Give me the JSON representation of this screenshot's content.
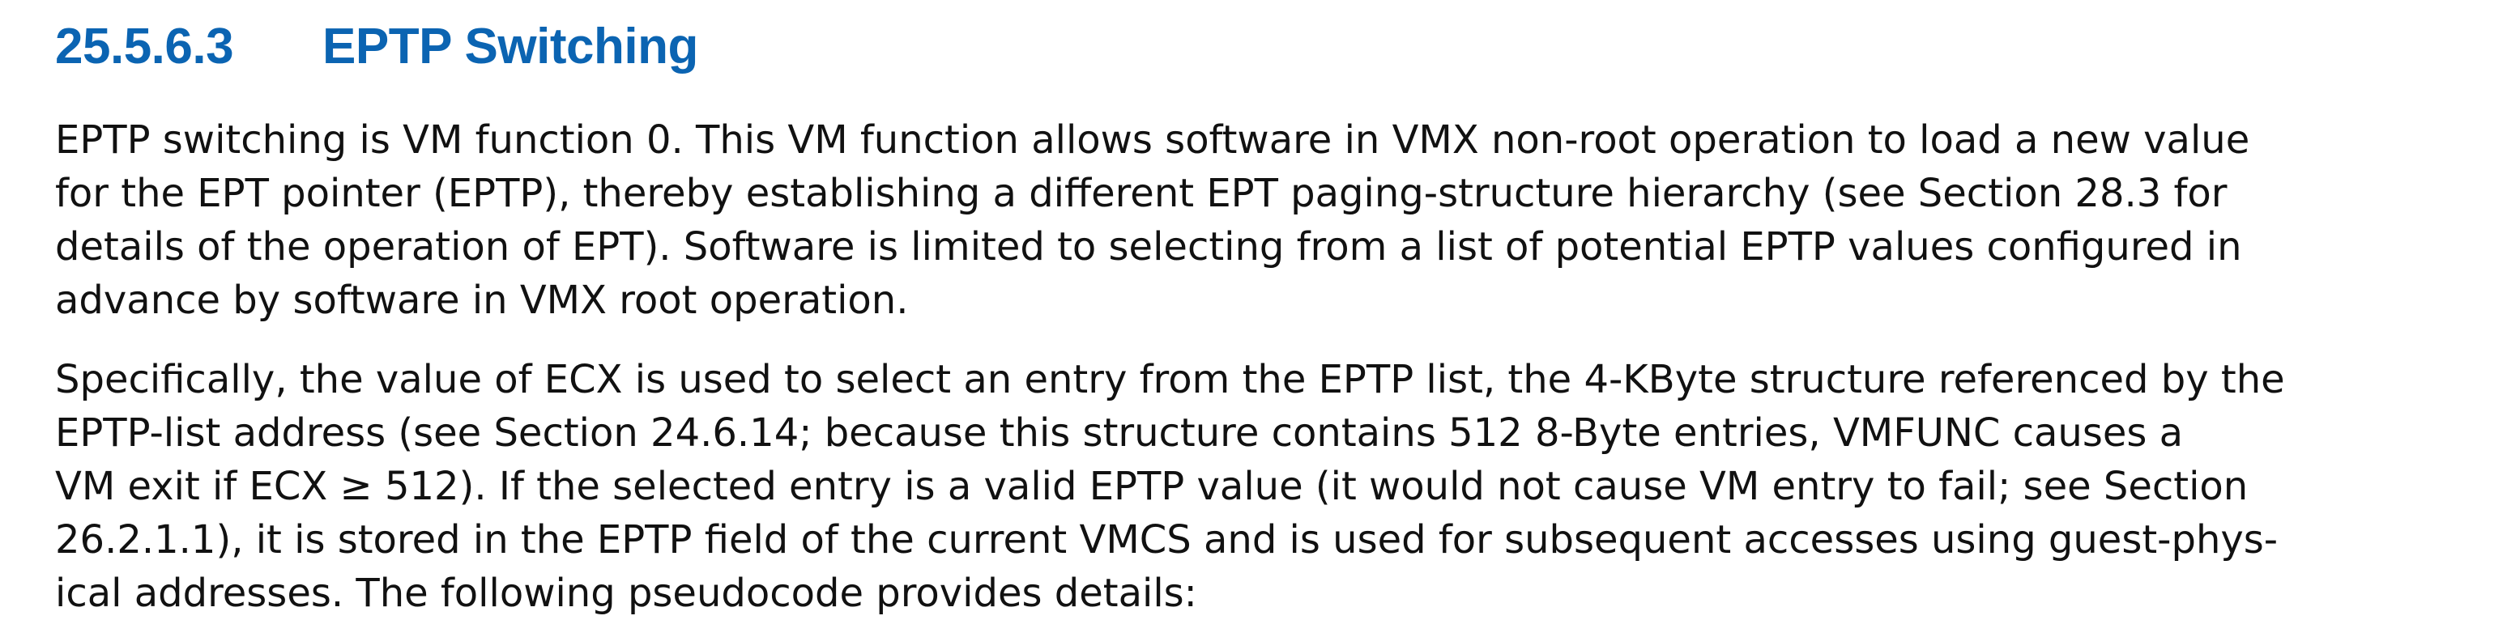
{
  "section": {
    "number": "25.5.6.3",
    "title": "EPTP Switching"
  },
  "paragraphs": [
    {
      "lines": [
        "EPTP switching is VM function 0. This VM function allows software in VMX non-root operation to load a new value",
        "for the EPT pointer (EPTP), thereby establishing a different EPT paging-structure hierarchy (see Section 28.3 for",
        "details of the operation of EPT). Software is limited to selecting from a list of potential EPTP values configured in",
        "advance by software in VMX root operation."
      ]
    },
    {
      "lines": [
        "Specifically, the value of ECX is used to select an entry from the EPTP list, the 4-KByte structure referenced by the",
        "EPTP-list address (see Section 24.6.14; because this structure contains 512 8-Byte entries, VMFUNC causes a",
        "VM exit if ECX ≥ 512). If the selected entry is a valid EPTP value (it would not cause VM entry to fail; see Section",
        "26.2.1.1), it is stored in the EPTP field of the current VMCS and is used for subsequent accesses using guest-phys-",
        "ical addresses. The following pseudocode provides details:"
      ]
    }
  ]
}
